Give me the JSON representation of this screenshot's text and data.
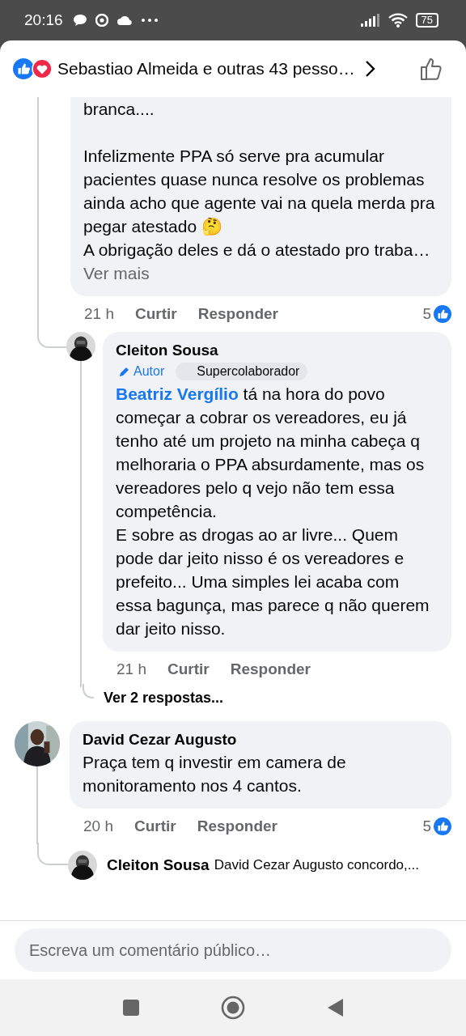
{
  "status_bar": {
    "time": "20:16",
    "battery": "75"
  },
  "header": {
    "reactions_text": "Sebastiao Almeida e outras 43 pesso…"
  },
  "comments": [
    {
      "text": "branca....\n\nInfelizmente PPA só serve pra acumular pacientes quase nunca resolve os problemas ainda acho que agente vai na quela merda pra pegar atestado 🤔\nA obrigação deles e dá o atestado pro traba…",
      "more_link": "Ver mais",
      "time": "21 h",
      "like": "Curtir",
      "reply": "Responder",
      "likes": "5",
      "replies": [
        {
          "kind": "full",
          "author": "Cleiton Sousa",
          "badges": [
            {
              "kind": "author",
              "label": "Autor"
            },
            {
              "kind": "role",
              "label": "Supercolaborador"
            }
          ],
          "mention": "Beatriz Vergílio",
          "text": "tá na hora do povo começar a cobrar os vereadores, eu já tenho até um projeto na minha cabeça q melhoraria o PPA absurdamente, mas os vereadores pelo q vejo não tem essa competência.\nE sobre as drogas ao ar livre... Quem pode dar jeito nisso é os vereadores e prefeito... Uma simples lei acaba com essa bagunça, mas parece q não querem dar jeito nisso.",
          "time": "21 h",
          "like": "Curtir",
          "reply": "Responder",
          "view_replies": "Ver 2 respostas..."
        }
      ]
    },
    {
      "author": "David Cezar Augusto",
      "text": "Praça tem q investir em camera de monitoramento nos 4 cantos.",
      "time": "20 h",
      "like": "Curtir",
      "reply": "Responder",
      "likes": "5",
      "replies": [
        {
          "kind": "preview",
          "author": "Cleiton Sousa",
          "text": "David Cezar Augusto concordo,..."
        }
      ]
    }
  ],
  "composer": {
    "placeholder": "Escreva um comentário público…"
  }
}
